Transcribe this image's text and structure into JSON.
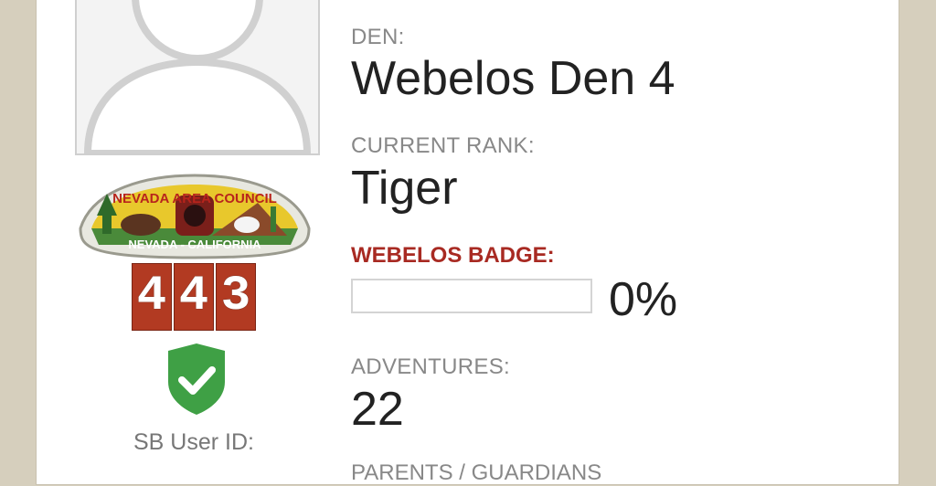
{
  "profile": {
    "userid_label": "SB User ID:",
    "unit_digits": [
      "4",
      "4",
      "3"
    ],
    "patch": {
      "top_text": "NEVADA AREA COUNCIL",
      "bottom_text": "NEVADA - CALIFORNIA"
    }
  },
  "fields": {
    "den_label": "DEN:",
    "den_value": "Webelos Den 4",
    "rank_label": "CURRENT RANK:",
    "rank_value": "Tiger",
    "badge_label": "WEBELOS BADGE:",
    "badge_progress": 0,
    "badge_progress_text": "0%",
    "adventures_label": "ADVENTURES:",
    "adventures_value": "22",
    "parents_label": "PARENTS / GUARDIANS"
  },
  "colors": {
    "background": "#d6cfbd",
    "badge_label": "#a82a22",
    "shield": "#3fa045",
    "unit_number_bg": "#b23a22"
  },
  "icons": {
    "avatar": "person-silhouette",
    "verified": "shield-check-icon"
  }
}
